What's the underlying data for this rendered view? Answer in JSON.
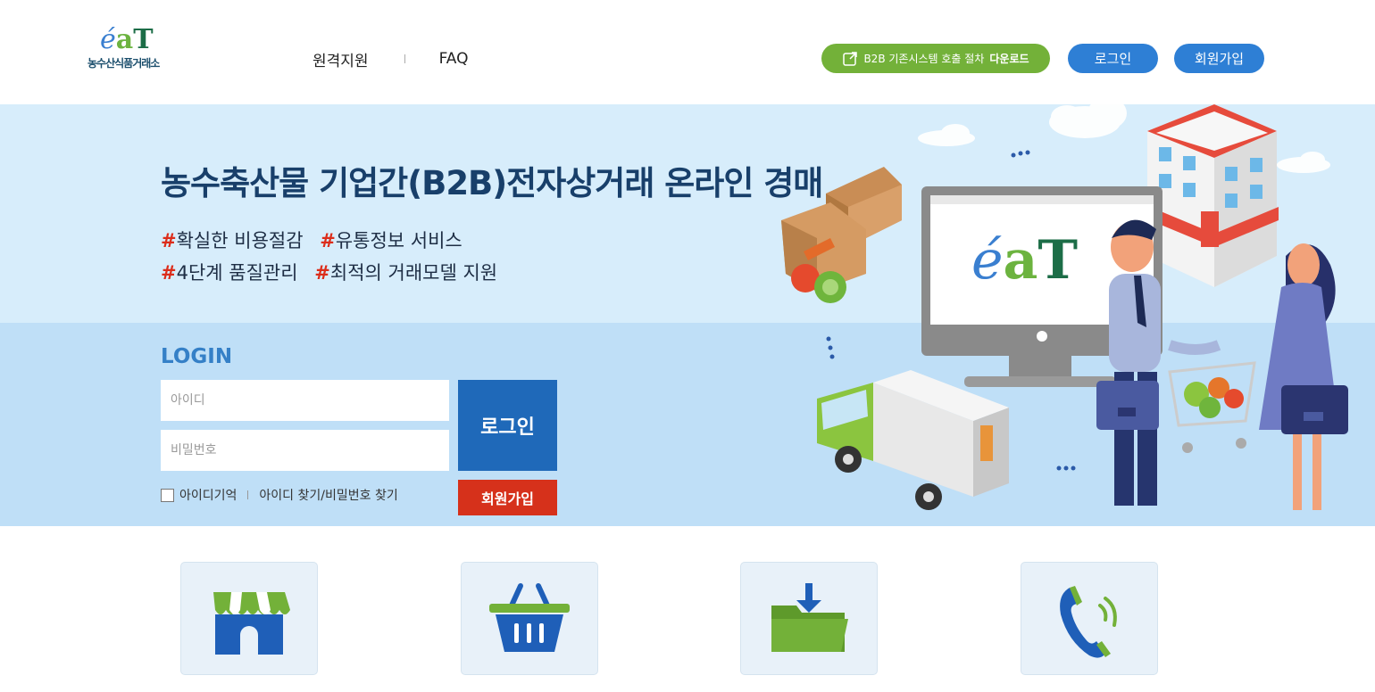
{
  "header": {
    "logo_alt": "eaT",
    "logo_text": "농수산식품거래소",
    "nav": [
      "원격지원",
      "FAQ"
    ],
    "download_button": {
      "prefix": "B2B 기존시스템 호출 절차",
      "bold": "다운로드"
    },
    "login_button": "로그인",
    "signup_button": "회원가입"
  },
  "hero": {
    "title": "농수축산물 기업간(B2B)전자상거래 온라인 경매",
    "tags_line1": [
      {
        "hash": "#",
        "text": "확실한 비용절감"
      },
      {
        "hash": "#",
        "text": "유통정보 서비스"
      }
    ],
    "tags_line2": [
      {
        "hash": "#",
        "text": "4단계 품질관리"
      },
      {
        "hash": "#",
        "text": "최적의 거래모델 지원"
      }
    ],
    "monitor_logo": "eaT"
  },
  "login": {
    "title": "LOGIN",
    "id_placeholder": "아이디",
    "pw_placeholder": "비밀번호",
    "submit": "로그인",
    "signup": "회원가입",
    "remember_label": "아이디기억",
    "find_link": "아이디 찾기/비밀번호 찾기"
  },
  "services": [
    {
      "icon": "store-icon"
    },
    {
      "icon": "basket-icon"
    },
    {
      "icon": "folder-download-icon"
    },
    {
      "icon": "phone-icon"
    }
  ],
  "colors": {
    "primary_blue": "#1f69b9",
    "accent_green": "#73b139",
    "accent_red": "#d6311b",
    "hero_light": "#d7edfb",
    "hero_mid": "#bfdff7"
  }
}
